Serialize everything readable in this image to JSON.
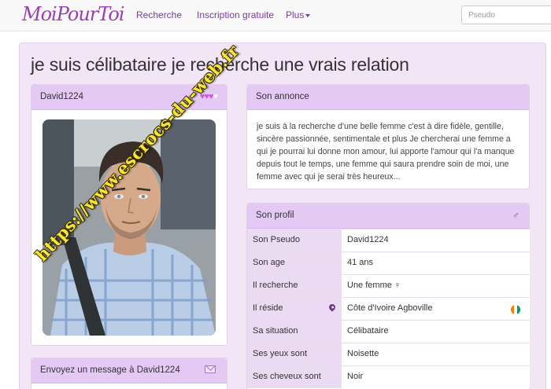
{
  "brand": {
    "logo_text": "MoiPourToi"
  },
  "nav": {
    "items": [
      {
        "label": "Recherche"
      },
      {
        "label": "Inscription gratuite"
      },
      {
        "label": "Plus"
      }
    ],
    "search_placeholder": "Pseudo"
  },
  "page": {
    "title": "je suis célibataire je recherche une vrais relation"
  },
  "profile_card": {
    "username": "David1224",
    "hearts_filled": 3,
    "hearts_total": 4,
    "watermark": "https://www.escrocs-du-web.fr"
  },
  "message_panel": {
    "label": "Envoyez un message à David1224"
  },
  "annonce": {
    "heading": "Son annonce",
    "text": "je suis à la recherche d'une belle femme c'est à dire fidèle, gentille, sincère passionnée, sentimentale et plus Je chercherai une femme a qui je pourrai lui donne mon amour, lui apporte l'amour qui l'a manque depuis tout le temps, une femme qui saura prendre soin de moi, une femme avec qui je serai très heureux..."
  },
  "profil": {
    "heading": "Son profil",
    "gender_symbol": "♂",
    "rows": [
      {
        "key": "Son Pseudo",
        "value": "David1224"
      },
      {
        "key": "Son age",
        "value": "41 ans"
      },
      {
        "key": "Il recherche",
        "value": "Une femme ♀"
      },
      {
        "key": "Il réside",
        "value": "Côte d'Ivoire Agboville"
      },
      {
        "key": "Sa situation",
        "value": "Célibataire"
      },
      {
        "key": "Ses yeux sont",
        "value": "Noisette"
      },
      {
        "key": "Ses cheveux sont",
        "value": "Noir"
      }
    ]
  },
  "colors": {
    "accent": "#7a3d99",
    "panel_header": "#e3c9f4",
    "background": "#f1e5f6",
    "flag": [
      "#f77f00",
      "#ffffff",
      "#009e60"
    ]
  }
}
